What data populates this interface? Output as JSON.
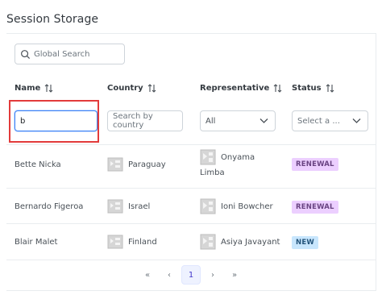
{
  "page": {
    "title": "Session Storage"
  },
  "global_search": {
    "placeholder": "Global Search",
    "value": ""
  },
  "columns": [
    {
      "label": "Name"
    },
    {
      "label": "Country"
    },
    {
      "label": "Representative"
    },
    {
      "label": "Status"
    }
  ],
  "filters": {
    "name_value": "b",
    "country_placeholder": "Search by country",
    "representative_value": "All",
    "status_placeholder": "Select a ..."
  },
  "rows": [
    {
      "name": "Bette Nicka",
      "country": "Paraguay",
      "rep_line1": "Onyama",
      "rep_line2": "Limba",
      "status": "RENEWAL",
      "status_kind": "renewal"
    },
    {
      "name": "Bernardo Figeroa",
      "country": "Israel",
      "rep_line1": "Ioni Bowcher",
      "rep_line2": "",
      "status": "RENEWAL",
      "status_kind": "renewal"
    },
    {
      "name": "Blair Malet",
      "country": "Finland",
      "rep_line1": "Asiya Javayant",
      "rep_line2": "",
      "status": "NEW",
      "status_kind": "new"
    }
  ],
  "paginator": {
    "first": "«",
    "prev": "‹",
    "current_page": "1",
    "next": "›",
    "last": "»"
  },
  "colors": {
    "accent": "#3b82f6",
    "highlight": "#e23b3b",
    "renewal_bg": "#eccfff",
    "new_bg": "#c8e6fd"
  },
  "icons": {
    "search": "search-icon",
    "sort": "sort-icon",
    "dropdown": "chevron-down-icon",
    "flag": "flag-placeholder-icon",
    "avatar": "avatar-placeholder-icon"
  }
}
